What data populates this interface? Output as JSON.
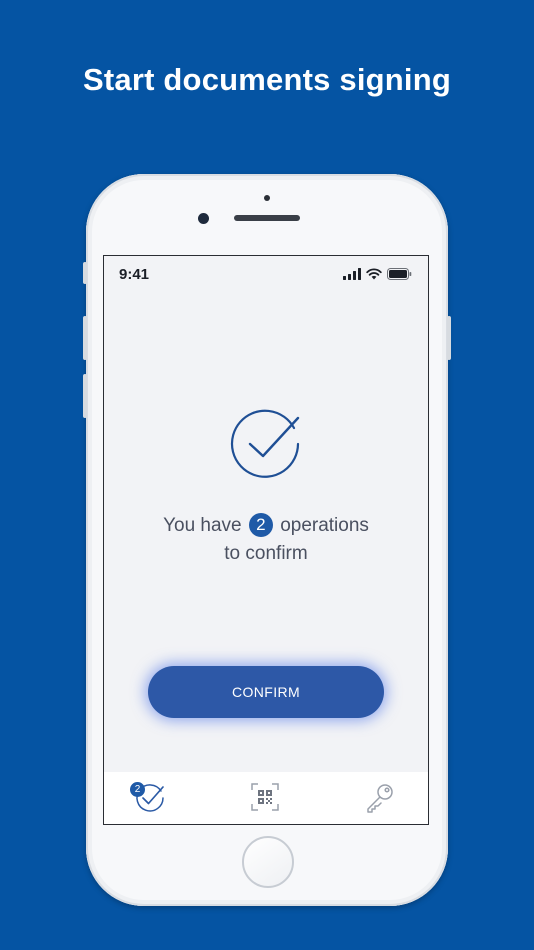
{
  "headline": "Start documents signing",
  "status_bar": {
    "time": "9:41",
    "icons": [
      "signal-icon",
      "wifi-icon",
      "battery-icon"
    ]
  },
  "main": {
    "message_prefix": "You have",
    "operations_count": "2",
    "message_suffix": "operations",
    "message_line2": "to confirm",
    "confirm_label": "CONFIRM"
  },
  "tabbar": {
    "tabs": [
      {
        "name": "operations",
        "icon": "check-circle-icon",
        "badge": "2",
        "active": true
      },
      {
        "name": "scan",
        "icon": "qr-code-icon",
        "active": false
      },
      {
        "name": "keys",
        "icon": "key-icon",
        "active": false
      }
    ]
  },
  "colors": {
    "background": "#0554a3",
    "accent": "#1f5aa7",
    "button": "#2d58a7",
    "screen": "#f2f3f6"
  }
}
